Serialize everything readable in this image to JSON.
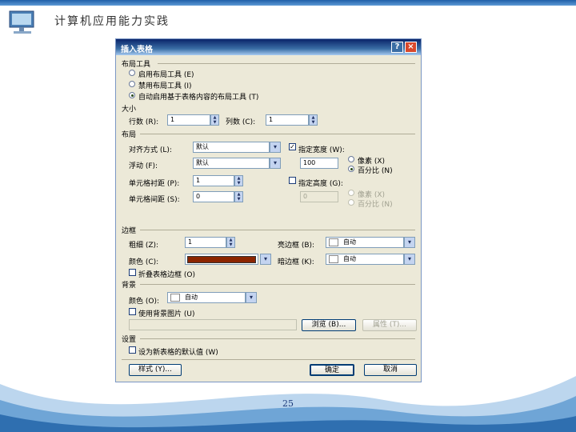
{
  "slide": {
    "title": "计算机应用能力实践",
    "page_number": "25"
  },
  "dialog": {
    "title": "插入表格",
    "help_label": "?",
    "close_label": "×",
    "layout_tools": {
      "heading": "布局工具",
      "options": [
        "启用布局工具 (E)",
        "禁用布局工具 (I)",
        "自动启用基于表格内容的布局工具 (T)"
      ]
    },
    "size": {
      "heading": "大小",
      "rows_label": "行数 (R):",
      "rows_value": "1",
      "cols_label": "列数 (C):",
      "cols_value": "1"
    },
    "layout": {
      "heading": "布局",
      "align_label": "对齐方式 (L):",
      "align_value": "默认",
      "float_label": "浮动 (F):",
      "float_value": "默认",
      "padding_label": "单元格衬距 (P):",
      "padding_value": "1",
      "spacing_label": "单元格间距 (S):",
      "spacing_value": "0",
      "width_check_label": "指定宽度 (W):",
      "width_value": "100",
      "width_unit_px": "像素 (X)",
      "width_unit_pct": "百分比 (N)",
      "height_check_label": "指定高度 (G):",
      "height_value": "0",
      "height_unit_px": "像素 (X)",
      "height_unit_pct": "百分比 (N)"
    },
    "borders": {
      "heading": "边框",
      "size_label": "粗细 (Z):",
      "size_value": "1",
      "color_label": "颜色 (C):",
      "light_label": "亮边框 (B):",
      "light_value": "自动",
      "dark_label": "暗边框 (K):",
      "dark_value": "自动",
      "collapse_label": "折叠表格边框 (O)",
      "border_color": "#8b2500"
    },
    "background": {
      "heading": "背景",
      "color_label": "颜色 (O):",
      "color_value": "自动",
      "image_check_label": "使用背景图片 (U)",
      "browse_label": "浏览 (B)...",
      "props_label": "属性 (T)..."
    },
    "settings": {
      "heading": "设置",
      "default_check_label": "设为新表格的默认值 (W)"
    },
    "style_label": "样式 (Y)...",
    "ok_label": "确定",
    "cancel_label": "取消"
  }
}
